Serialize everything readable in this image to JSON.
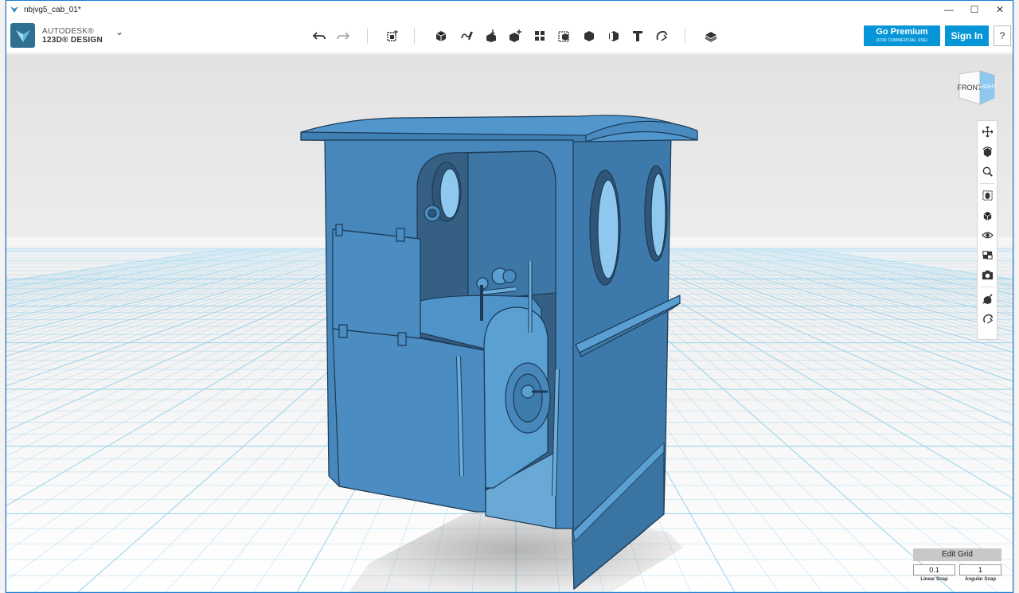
{
  "window": {
    "title": "nbjvg5_cab_01*",
    "minimize": "—",
    "maximize": "☐",
    "close": "✕"
  },
  "brand": {
    "line1": "AUTODESK®",
    "line2": "123D® DESIGN",
    "menu_chevron": "⌄"
  },
  "toolbar": {
    "tools": [
      "undo-icon",
      "redo-icon",
      "transform-icon",
      "primitives-icon",
      "sketch-icon",
      "construct-icon",
      "modify-icon",
      "pattern-icon",
      "grouping-icon",
      "combine-icon",
      "measure-icon",
      "text-icon",
      "snap-icon",
      "material-icon"
    ],
    "premium_label": "Go Premium",
    "premium_sub": "(FOR COMMERCIAL USE)",
    "signin_label": "Sign In",
    "help_label": "?"
  },
  "viewcube": {
    "front": "FRONT",
    "right": "RIGHT"
  },
  "navbar": {
    "items": [
      "pan-icon",
      "orbit-icon",
      "zoom-icon",
      "fit-icon",
      "views-icon",
      "visibility-icon",
      "materials-view-icon",
      "screenshot-icon",
      "hide-sketch-icon",
      "snap-icon"
    ]
  },
  "edit_grid": {
    "title": "Edit Grid",
    "linear_value": "0.1",
    "linear_label": "Linear Snap",
    "angular_value": "1",
    "angular_label": "Angular Snap"
  },
  "colors": {
    "accent": "#0696d7",
    "model": "#4a90c2",
    "grid": "#9fd4ec",
    "background_top": "#e7e7e7",
    "background_bottom": "#ffffff"
  }
}
